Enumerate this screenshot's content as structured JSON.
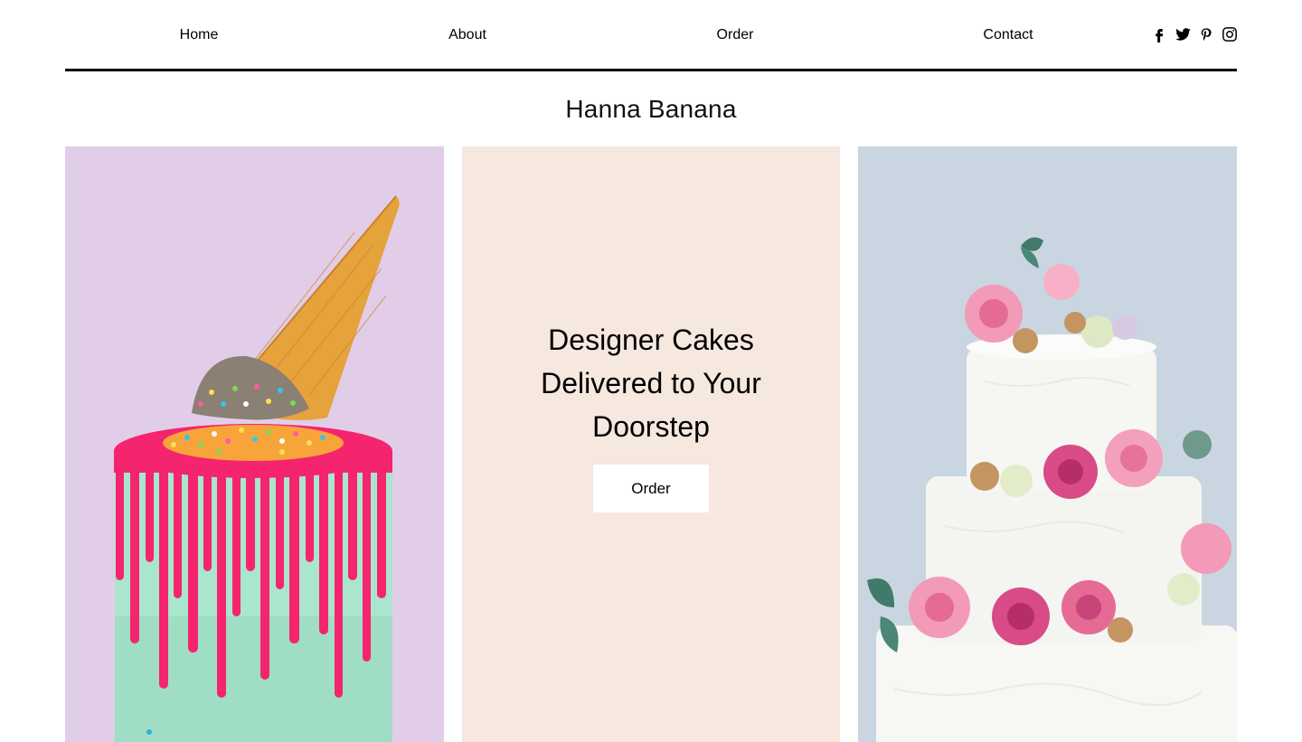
{
  "nav": {
    "items": [
      {
        "label": "Home"
      },
      {
        "label": "About"
      },
      {
        "label": "Order"
      },
      {
        "label": "Contact"
      }
    ],
    "social": [
      {
        "icon": "facebook-icon"
      },
      {
        "icon": "twitter-icon"
      },
      {
        "icon": "pinterest-icon"
      },
      {
        "icon": "instagram-icon"
      }
    ]
  },
  "brand": {
    "name": "Hanna Banana"
  },
  "hero": {
    "lines": [
      "Designer Cakes",
      "Delivered to Your",
      "Doorstep"
    ],
    "button_label": "Order"
  },
  "colors": {
    "left_panel_bg": "#e2cde8",
    "mid_panel_bg": "#f6e7df",
    "right_panel_bg": "#c9d6e1",
    "drip_pink": "#f5246e",
    "mint_cake": "#a9e6cd",
    "cone": "#e6a23b"
  },
  "images": {
    "left": "ice-cream-cone-drip-cake",
    "right": "three-tier-white-floral-cake"
  }
}
